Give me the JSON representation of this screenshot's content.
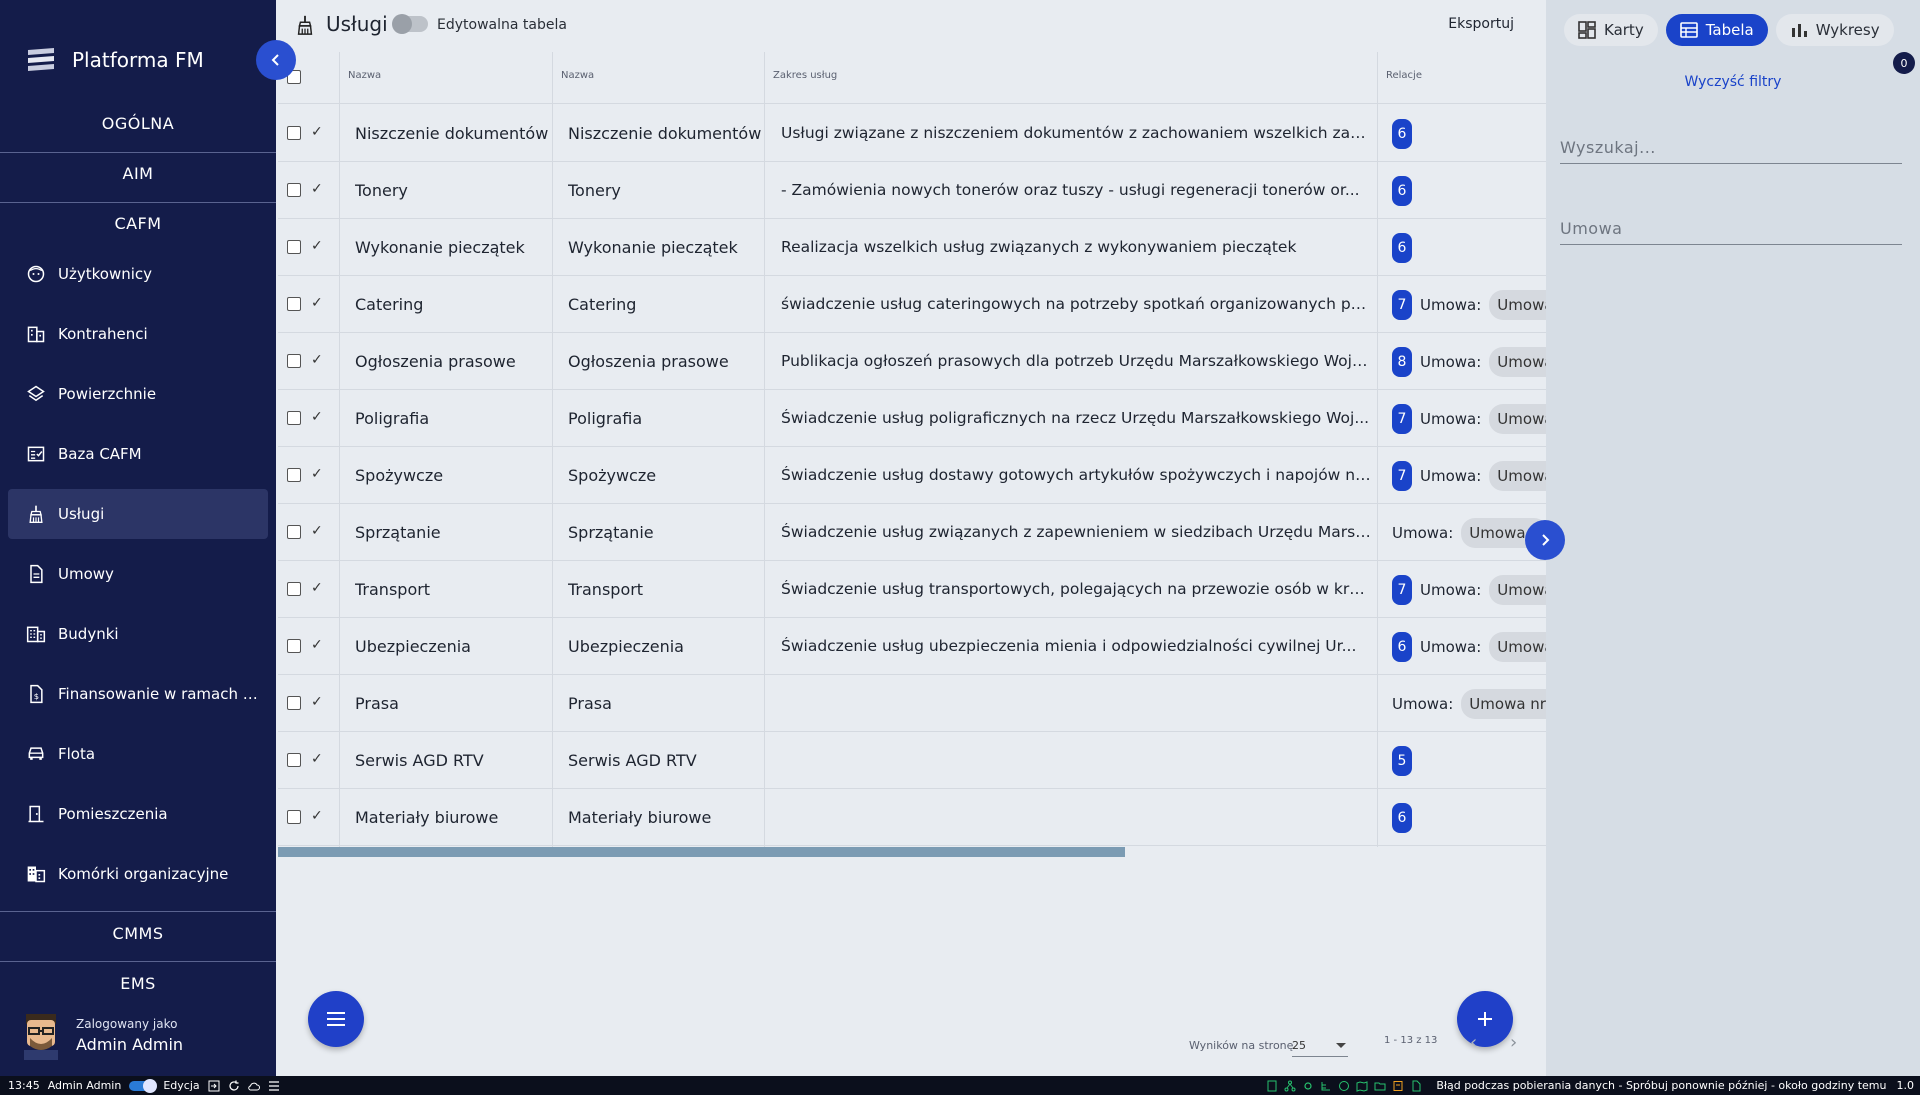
{
  "app": {
    "brand": "Platforma FM"
  },
  "sidebar": {
    "sections": [
      "OGÓLNA",
      "AIM",
      "CAFM",
      "CMMS",
      "EMS"
    ],
    "items": [
      {
        "label": "Użytkownicy",
        "icon": "face-icon"
      },
      {
        "label": "Kontrahenci",
        "icon": "business-icon"
      },
      {
        "label": "Powierzchnie",
        "icon": "layers-icon"
      },
      {
        "label": "Baza CAFM",
        "icon": "fact-check-icon"
      },
      {
        "label": "Usługi",
        "icon": "cleaning-icon",
        "active": true
      },
      {
        "label": "Umowy",
        "icon": "document-icon"
      },
      {
        "label": "Budynki",
        "icon": "building-icon"
      },
      {
        "label": "Finansowanie w ramach p...",
        "icon": "finance-icon"
      },
      {
        "label": "Flota",
        "icon": "car-icon"
      },
      {
        "label": "Pomieszczenia",
        "icon": "door-icon"
      },
      {
        "label": "Komórki organizacyjne",
        "icon": "domain-icon"
      }
    ],
    "user": {
      "caption": "Zalogowany jako",
      "name": "Admin Admin"
    }
  },
  "header": {
    "title": "Usługi",
    "toggle_label": "Edytowalna tabela",
    "export_label": "Eksportuj"
  },
  "table": {
    "columns": [
      "Nazwa",
      "Nazwa",
      "Zakres usług",
      "Relacje"
    ],
    "rows": [
      {
        "name": "Niszczenie dokumentów",
        "name2": "Niszczenie dokumentów",
        "scope": "Usługi związane z niszczeniem dokumentów z zachowaniem wszelkich zasad...",
        "count": "6",
        "rel_label": "",
        "chip": ""
      },
      {
        "name": "Tonery",
        "name2": "Tonery",
        "scope": "- Zamówienia nowych tonerów oraz tuszy - usługi regeneracji tonerów or...",
        "count": "6",
        "rel_label": "",
        "chip": ""
      },
      {
        "name": "Wykonanie pieczątek",
        "name2": "Wykonanie pieczątek",
        "scope": "Realizacja wszelkich usług związanych z wykonywaniem pieczątek",
        "count": "6",
        "rel_label": "",
        "chip": ""
      },
      {
        "name": "Catering",
        "name2": "Catering",
        "scope": "świadczenie usług cateringowych na potrzeby spotkań organizowanych prz...",
        "count": "7",
        "rel_label": "Umowa:",
        "chip": "Umowa"
      },
      {
        "name": "Ogłoszenia prasowe",
        "name2": "Ogłoszenia prasowe",
        "scope": "Publikacja ogłoszeń prasowych dla potrzeb Urzędu Marszałkowskiego Woje...",
        "count": "8",
        "rel_label": "Umowa:",
        "chip": "Umowa"
      },
      {
        "name": "Poligrafia",
        "name2": "Poligrafia",
        "scope": "Świadczenie usług poligraficznych na rzecz Urzędu Marszałkowskiego Woj...",
        "count": "7",
        "rel_label": "Umowa:",
        "chip": "Umowa"
      },
      {
        "name": "Spożywcze",
        "name2": "Spożywcze",
        "scope": "Świadczenie usług dostawy gotowych artykułów spożywczych i napojów na ...",
        "count": "7",
        "rel_label": "Umowa:",
        "chip": "Umowa"
      },
      {
        "name": "Sprzątanie",
        "name2": "Sprzątanie",
        "scope": "Świadczenie usług związanych z zapewnieniem w siedzibach Urzędu Marsza...",
        "count": "",
        "rel_label": "Umowa:",
        "chip": "Umowa n"
      },
      {
        "name": "Transport",
        "name2": "Transport",
        "scope": "Świadczenie usług transportowych, polegających na przewozie osób w kra...",
        "count": "7",
        "rel_label": "Umowa:",
        "chip": "Umowa"
      },
      {
        "name": "Ubezpieczenia",
        "name2": "Ubezpieczenia",
        "scope": "Świadczenie usług ubezpieczenia mienia i odpowiedzialności cywilnej Ur...",
        "count": "6",
        "rel_label": "Umowa:",
        "chip": "Umowa"
      },
      {
        "name": "Prasa",
        "name2": "Prasa",
        "scope": "",
        "count": "",
        "rel_label": "Umowa:",
        "chip": "Umowa nr W"
      },
      {
        "name": "Serwis AGD RTV",
        "name2": "Serwis AGD RTV",
        "scope": "",
        "count": "5",
        "rel_label": "",
        "chip": ""
      },
      {
        "name": "Materiały biurowe",
        "name2": "Materiały biurowe",
        "scope": "",
        "count": "6",
        "rel_label": "",
        "chip": ""
      }
    ]
  },
  "pager": {
    "label": "Wyników na stronę",
    "per_page": "25",
    "range": "1 - 13 z 13"
  },
  "right_panel": {
    "tabs": [
      {
        "label": "Karty",
        "icon": "dashboard-icon"
      },
      {
        "label": "Tabela",
        "icon": "table-icon",
        "active": true
      },
      {
        "label": "Wykresy",
        "icon": "bar-chart-icon"
      }
    ],
    "filter_count": "0",
    "clear_label": "Wyczyść filtry",
    "search_placeholder": "Wyszukaj...",
    "contract_placeholder": "Umowa"
  },
  "statusbar": {
    "time": "13:45",
    "user": "Admin Admin",
    "edit_label": "Edycja",
    "error": "Błąd podczas pobierania danych - Spróbuj ponownie później - około godziny temu",
    "version": "1.0"
  },
  "colors": {
    "sidebar_bg": "#141c4a",
    "accent": "#1a43c9",
    "panel_bg": "#d6dde5",
    "content_bg": "#e8ecf1"
  }
}
